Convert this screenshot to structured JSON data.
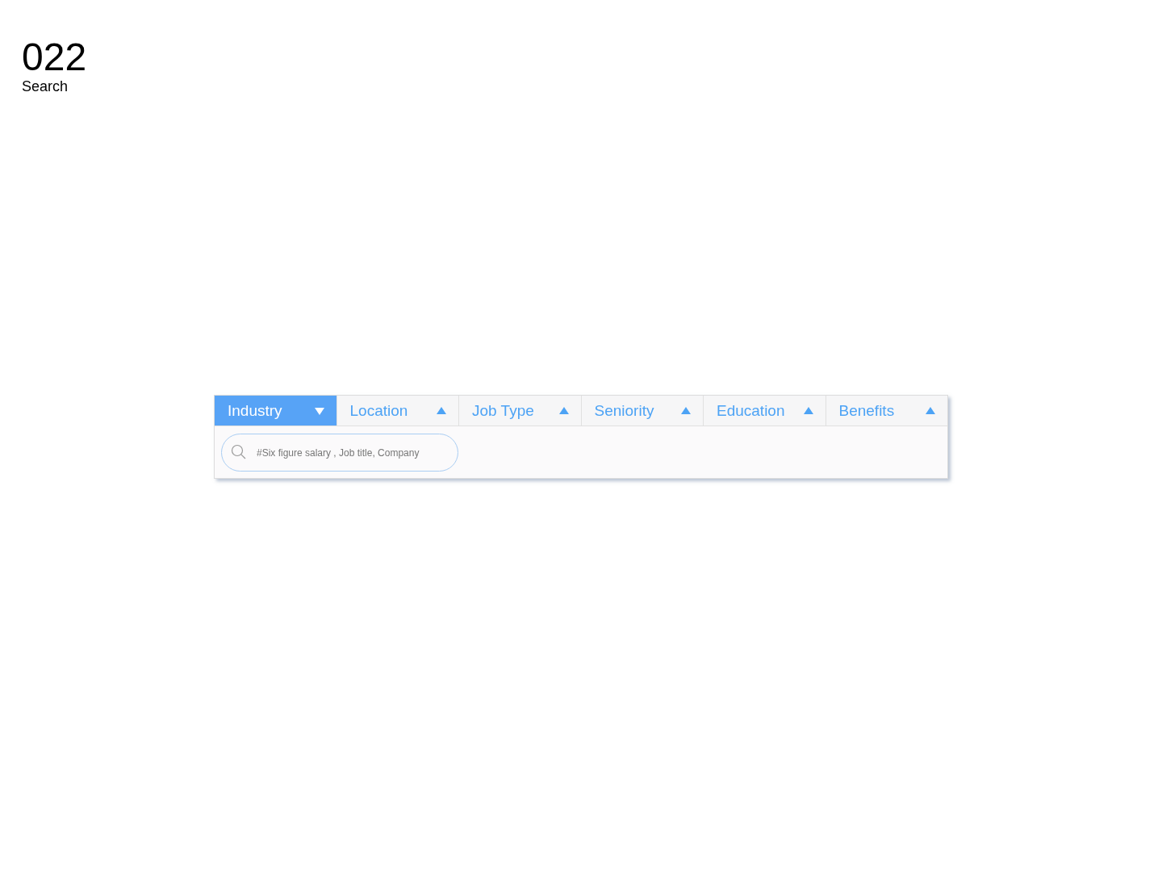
{
  "header": {
    "number": "022",
    "title": "Search"
  },
  "filters": [
    {
      "label": "Industry",
      "selected": true
    },
    {
      "label": "Location",
      "selected": false
    },
    {
      "label": "Job Type",
      "selected": false
    },
    {
      "label": "Seniority",
      "selected": false
    },
    {
      "label": "Education",
      "selected": false
    },
    {
      "label": "Benefits",
      "selected": false
    }
  ],
  "search": {
    "placeholder": "#Six figure salary , Job title, Company"
  }
}
